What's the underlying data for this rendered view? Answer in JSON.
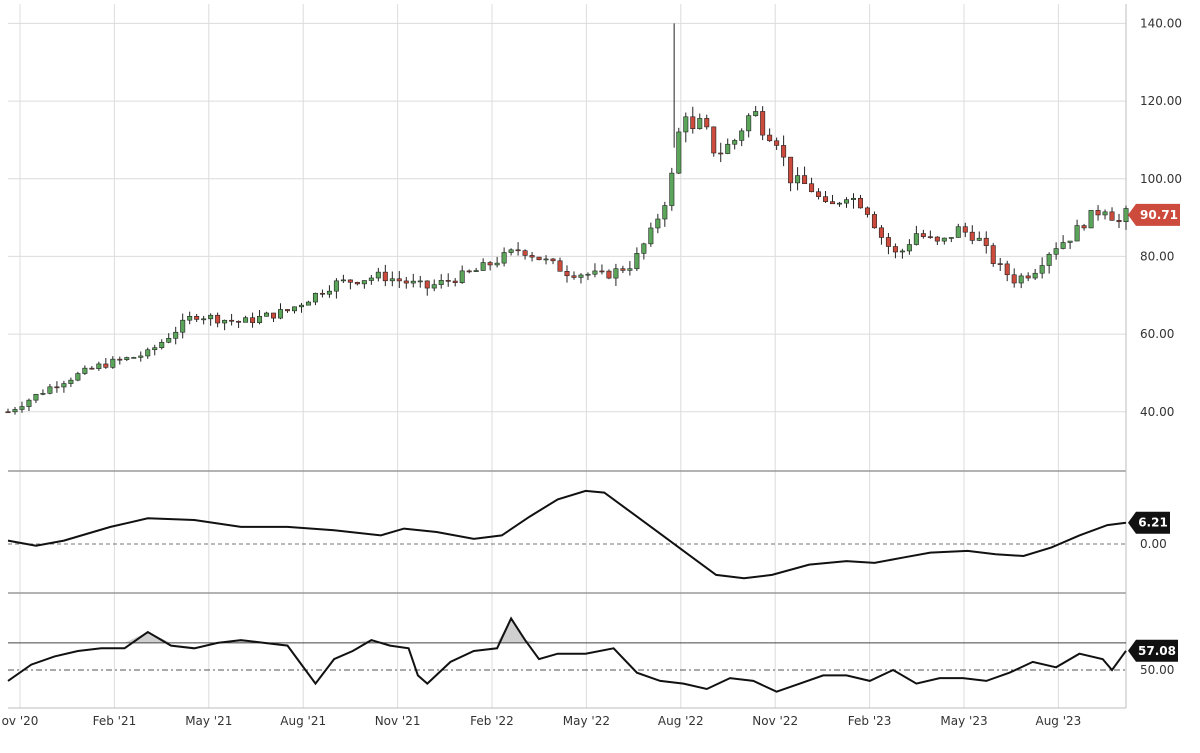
{
  "chart_data": {
    "type": "candlestick",
    "x_ticks": [
      "ov '20",
      "Feb '21",
      "May '21",
      "Aug '21",
      "Nov '21",
      "Feb '22",
      "May '22",
      "Aug '22",
      "Nov '22",
      "Feb '23",
      "May '23",
      "Aug '23"
    ],
    "price_panel": {
      "y_ticks": [
        "140.00",
        "120.00",
        "100.00",
        "80.00",
        "60.00",
        "40.00"
      ],
      "ylim": [
        25,
        145
      ],
      "last_price_label": "90.71",
      "last_price": 90.71,
      "candle_colors": {
        "up": "#5aa55a",
        "down": "#cc4b3c",
        "wick": "#222222"
      },
      "series_points": [
        [
          0,
          40
        ],
        [
          10,
          47
        ],
        [
          20,
          52
        ],
        [
          30,
          55
        ],
        [
          40,
          65
        ],
        [
          50,
          63
        ],
        [
          60,
          66
        ],
        [
          70,
          73
        ],
        [
          80,
          75
        ],
        [
          90,
          72
        ],
        [
          100,
          76
        ],
        [
          110,
          82
        ],
        [
          120,
          76
        ],
        [
          128,
          75
        ],
        [
          134,
          78
        ],
        [
          138,
          86
        ],
        [
          142,
          97
        ],
        [
          145,
          119
        ],
        [
          147,
          112
        ],
        [
          149,
          115
        ],
        [
          152,
          106
        ],
        [
          156,
          110
        ],
        [
          160,
          118
        ],
        [
          162,
          113
        ],
        [
          165,
          110
        ],
        [
          168,
          100
        ],
        [
          172,
          98
        ],
        [
          176,
          92
        ],
        [
          180,
          96
        ],
        [
          184,
          93
        ],
        [
          188,
          84
        ],
        [
          191,
          80
        ],
        [
          195,
          86
        ],
        [
          200,
          83
        ],
        [
          204,
          87
        ],
        [
          208,
          85
        ],
        [
          212,
          78
        ],
        [
          216,
          74
        ],
        [
          220,
          76
        ],
        [
          224,
          82
        ],
        [
          228,
          85
        ],
        [
          232,
          90
        ],
        [
          236,
          93
        ],
        [
          238,
          88
        ],
        [
          240,
          91
        ]
      ]
    },
    "oscillator_panel": {
      "zero_label": "0.00",
      "last_value_label": "6.21",
      "ylim": [
        -14,
        21
      ],
      "points": [
        [
          0,
          1
        ],
        [
          6,
          -0.5
        ],
        [
          12,
          1
        ],
        [
          22,
          5
        ],
        [
          30,
          7.5
        ],
        [
          40,
          7
        ],
        [
          50,
          5
        ],
        [
          60,
          5
        ],
        [
          70,
          4
        ],
        [
          80,
          2.5
        ],
        [
          85,
          4.5
        ],
        [
          92,
          3.5
        ],
        [
          100,
          1.5
        ],
        [
          106,
          2.5
        ],
        [
          112,
          8
        ],
        [
          118,
          13
        ],
        [
          124,
          15.5
        ],
        [
          128,
          15
        ],
        [
          134,
          9
        ],
        [
          140,
          3
        ],
        [
          146,
          -3
        ],
        [
          152,
          -9
        ],
        [
          158,
          -10
        ],
        [
          164,
          -9
        ],
        [
          172,
          -6
        ],
        [
          180,
          -5
        ],
        [
          186,
          -5.5
        ],
        [
          192,
          -4
        ],
        [
          198,
          -2.5
        ],
        [
          206,
          -2
        ],
        [
          212,
          -3
        ],
        [
          218,
          -3.5
        ],
        [
          224,
          -1
        ],
        [
          230,
          2.5
        ],
        [
          236,
          5.5
        ],
        [
          240,
          6.21
        ]
      ]
    },
    "rsi_panel": {
      "label_50": "50.00",
      "last_value_label": "57.08",
      "ylim": [
        36,
        78
      ],
      "upper_line": 60,
      "mid_line": 50,
      "points": [
        [
          0,
          46
        ],
        [
          5,
          52
        ],
        [
          10,
          55
        ],
        [
          15,
          57
        ],
        [
          20,
          58
        ],
        [
          25,
          58
        ],
        [
          30,
          64
        ],
        [
          35,
          59
        ],
        [
          40,
          58
        ],
        [
          45,
          60
        ],
        [
          50,
          61
        ],
        [
          55,
          60
        ],
        [
          60,
          59
        ],
        [
          63,
          52
        ],
        [
          66,
          45
        ],
        [
          70,
          54
        ],
        [
          74,
          57
        ],
        [
          78,
          61
        ],
        [
          82,
          59
        ],
        [
          86,
          58
        ],
        [
          88,
          48
        ],
        [
          90,
          45
        ],
        [
          95,
          53
        ],
        [
          100,
          57
        ],
        [
          105,
          58
        ],
        [
          108,
          69
        ],
        [
          111,
          61
        ],
        [
          114,
          54
        ],
        [
          118,
          56
        ],
        [
          124,
          56
        ],
        [
          130,
          58
        ],
        [
          135,
          49
        ],
        [
          140,
          46
        ],
        [
          145,
          45
        ],
        [
          150,
          43
        ],
        [
          155,
          47
        ],
        [
          160,
          46
        ],
        [
          165,
          42
        ],
        [
          170,
          45
        ],
        [
          175,
          48
        ],
        [
          180,
          48
        ],
        [
          185,
          46
        ],
        [
          190,
          50
        ],
        [
          195,
          45
        ],
        [
          200,
          47
        ],
        [
          205,
          47
        ],
        [
          210,
          46
        ],
        [
          215,
          49
        ],
        [
          220,
          53
        ],
        [
          225,
          51
        ],
        [
          230,
          56
        ],
        [
          235,
          54
        ],
        [
          237,
          50
        ],
        [
          240,
          57.08
        ]
      ]
    }
  }
}
